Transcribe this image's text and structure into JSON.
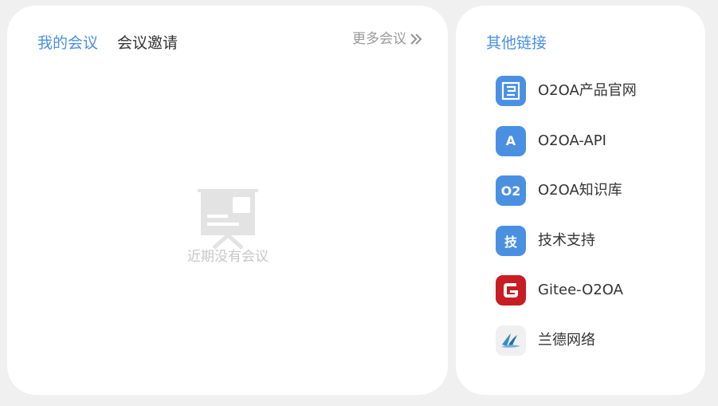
{
  "meetings": {
    "tabs": [
      {
        "label": "我的会议",
        "active": true
      },
      {
        "label": "会议邀请",
        "active": false
      }
    ],
    "more_label": "更多会议",
    "more_icon": "double-chevron-right-icon",
    "empty_icon": "presentation-board-icon",
    "empty_text": "近期没有会议"
  },
  "links": {
    "title": "其他链接",
    "items": [
      {
        "label": "O2OA产品官网",
        "icon": "o2oa-logo-icon",
        "icon_color": "#4a90e2"
      },
      {
        "label": "O2OA-API",
        "icon": "letter-a-icon",
        "icon_text": "A",
        "icon_color": "#4a90e2"
      },
      {
        "label": "O2OA知识库",
        "icon": "o2-icon",
        "icon_text": "O2",
        "icon_color": "#4a90e2"
      },
      {
        "label": "技术支持",
        "icon": "tech-support-icon",
        "icon_text": "技",
        "icon_color": "#4a90e2"
      },
      {
        "label": "Gitee-O2OA",
        "icon": "gitee-logo-icon",
        "icon_color": "#c71d23"
      },
      {
        "label": "兰德网络",
        "icon": "lande-logo-icon",
        "icon_color": "#f0f0f0"
      }
    ]
  },
  "colors": {
    "accent": "#4a90e2",
    "background": "#f0f0f0",
    "card": "#ffffff",
    "text": "#333333",
    "muted": "#999999",
    "placeholder": "#c8c8c8"
  }
}
